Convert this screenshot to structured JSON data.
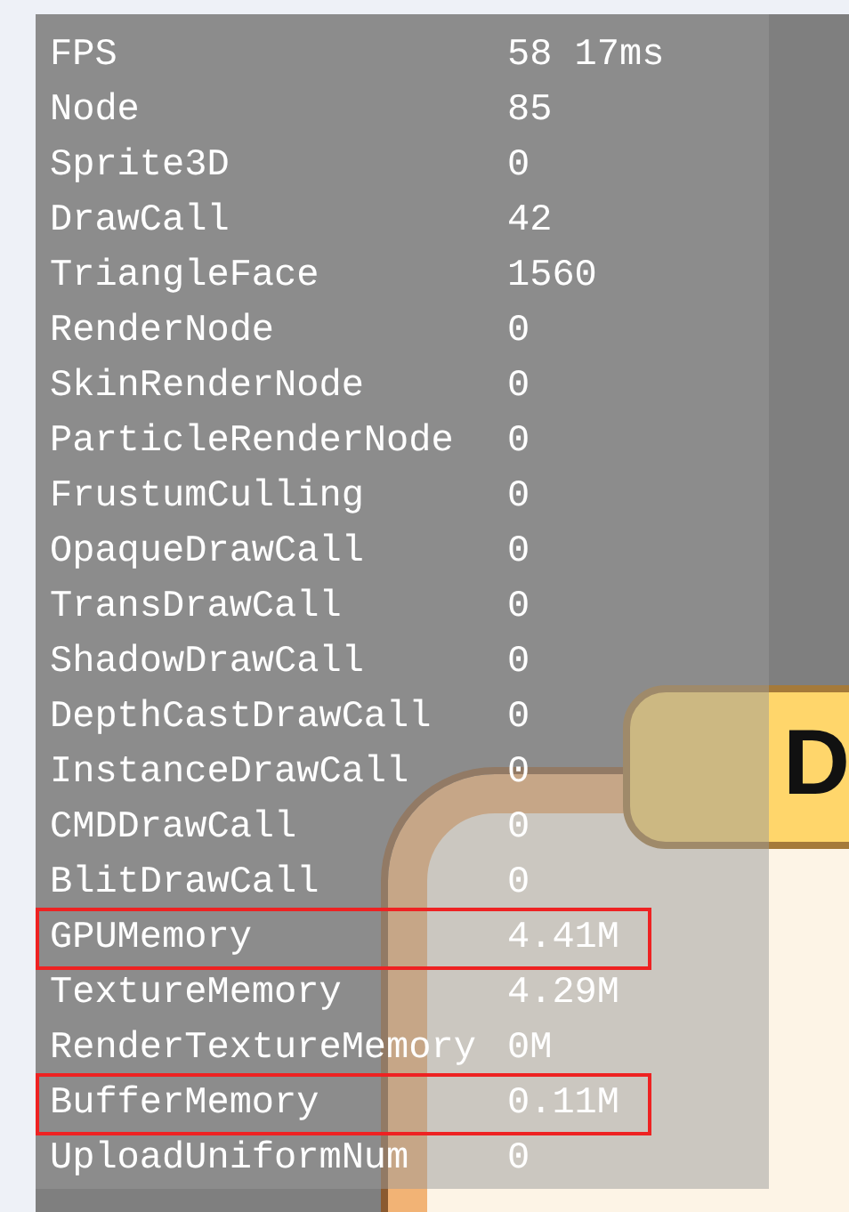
{
  "stats": [
    {
      "label": "FPS",
      "value": "58 17ms",
      "highlighted": false
    },
    {
      "label": "Node",
      "value": "85",
      "highlighted": false
    },
    {
      "label": "Sprite3D",
      "value": "0",
      "highlighted": false
    },
    {
      "label": "DrawCall",
      "value": "42",
      "highlighted": false
    },
    {
      "label": "TriangleFace",
      "value": "1560",
      "highlighted": false
    },
    {
      "label": "RenderNode",
      "value": "0",
      "highlighted": false
    },
    {
      "label": "SkinRenderNode",
      "value": "0",
      "highlighted": false
    },
    {
      "label": "ParticleRenderNode",
      "value": "0",
      "highlighted": false
    },
    {
      "label": "FrustumCulling",
      "value": "0",
      "highlighted": false
    },
    {
      "label": "OpaqueDrawCall",
      "value": "0",
      "highlighted": false
    },
    {
      "label": "TransDrawCall",
      "value": "0",
      "highlighted": false
    },
    {
      "label": "ShadowDrawCall",
      "value": "0",
      "highlighted": false
    },
    {
      "label": "DepthCastDrawCall",
      "value": "0",
      "highlighted": false
    },
    {
      "label": "InstanceDrawCall",
      "value": "0",
      "highlighted": false
    },
    {
      "label": "CMDDrawCall",
      "value": "0",
      "highlighted": false
    },
    {
      "label": "BlitDrawCall",
      "value": "0",
      "highlighted": false
    },
    {
      "label": "GPUMemory",
      "value": "4.41M",
      "highlighted": true
    },
    {
      "label": "TextureMemory",
      "value": "4.29M",
      "highlighted": false
    },
    {
      "label": "RenderTextureMemory",
      "value": "0M",
      "highlighted": false
    },
    {
      "label": "BufferMemory",
      "value": "0.11M",
      "highlighted": true
    },
    {
      "label": "UploadUniformNum",
      "value": "0",
      "highlighted": false
    }
  ],
  "game": {
    "banner_text": "D"
  }
}
